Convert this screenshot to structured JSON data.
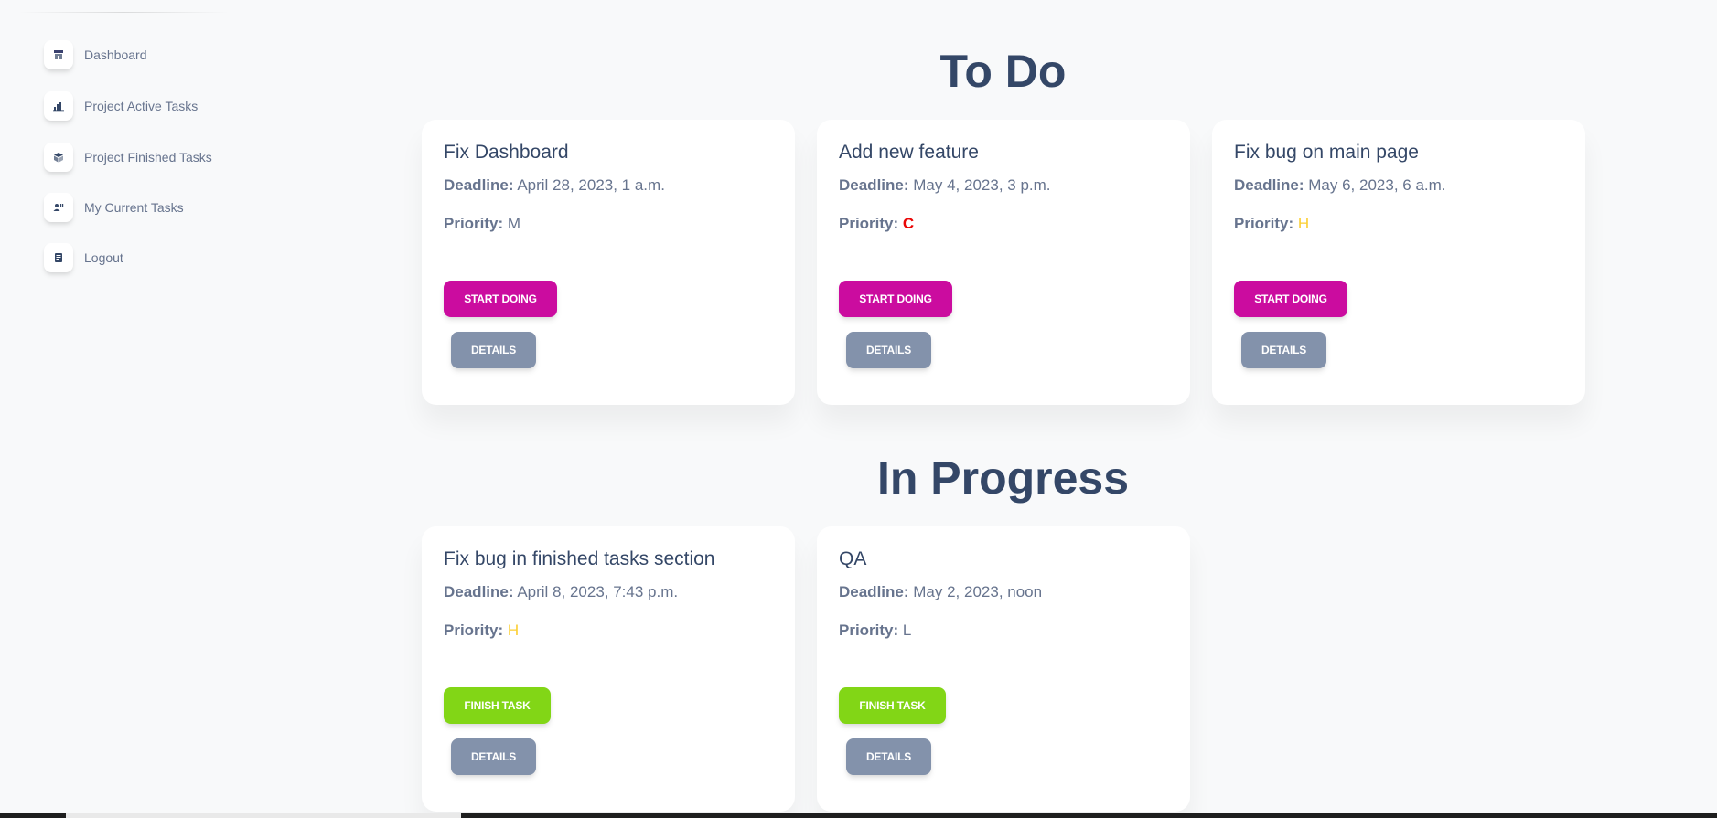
{
  "sidebar": {
    "items": [
      {
        "label": "Dashboard",
        "icon": "shop-icon"
      },
      {
        "label": "Project Active Tasks",
        "icon": "chart-bar-icon"
      },
      {
        "label": "Project Finished Tasks",
        "icon": "box-3d-icon"
      },
      {
        "label": "My Current Tasks",
        "icon": "user-tasks-icon"
      },
      {
        "label": "Logout",
        "icon": "document-icon"
      }
    ]
  },
  "labels": {
    "deadline": "Deadline:",
    "priority": "Priority:",
    "start_doing": "START DOING",
    "finish_task": "FINISH TASK",
    "details": "DETAILS"
  },
  "colors": {
    "accent_primary": "#cb0c9f",
    "accent_success": "#82d616",
    "button_secondary": "#8392ab",
    "priority_M": "#67748e",
    "priority_C": "#ea0606",
    "priority_H": "#fbcf33",
    "priority_L": "#67748e"
  },
  "sections": {
    "todo": {
      "title": "To Do",
      "tasks": [
        {
          "title": "Fix Dashboard",
          "deadline": "April 28, 2023, 1 a.m.",
          "priority": "M"
        },
        {
          "title": "Add new feature",
          "deadline": "May 4, 2023, 3 p.m.",
          "priority": "C"
        },
        {
          "title": "Fix bug on main page",
          "deadline": "May 6, 2023, 6 a.m.",
          "priority": "H"
        }
      ]
    },
    "in_progress": {
      "title": "In Progress",
      "tasks": [
        {
          "title": "Fix bug in finished tasks section",
          "deadline": "April 8, 2023, 7:43 p.m.",
          "priority": "H"
        },
        {
          "title": "QA",
          "deadline": "May 2, 2023, noon",
          "priority": "L"
        }
      ]
    }
  }
}
